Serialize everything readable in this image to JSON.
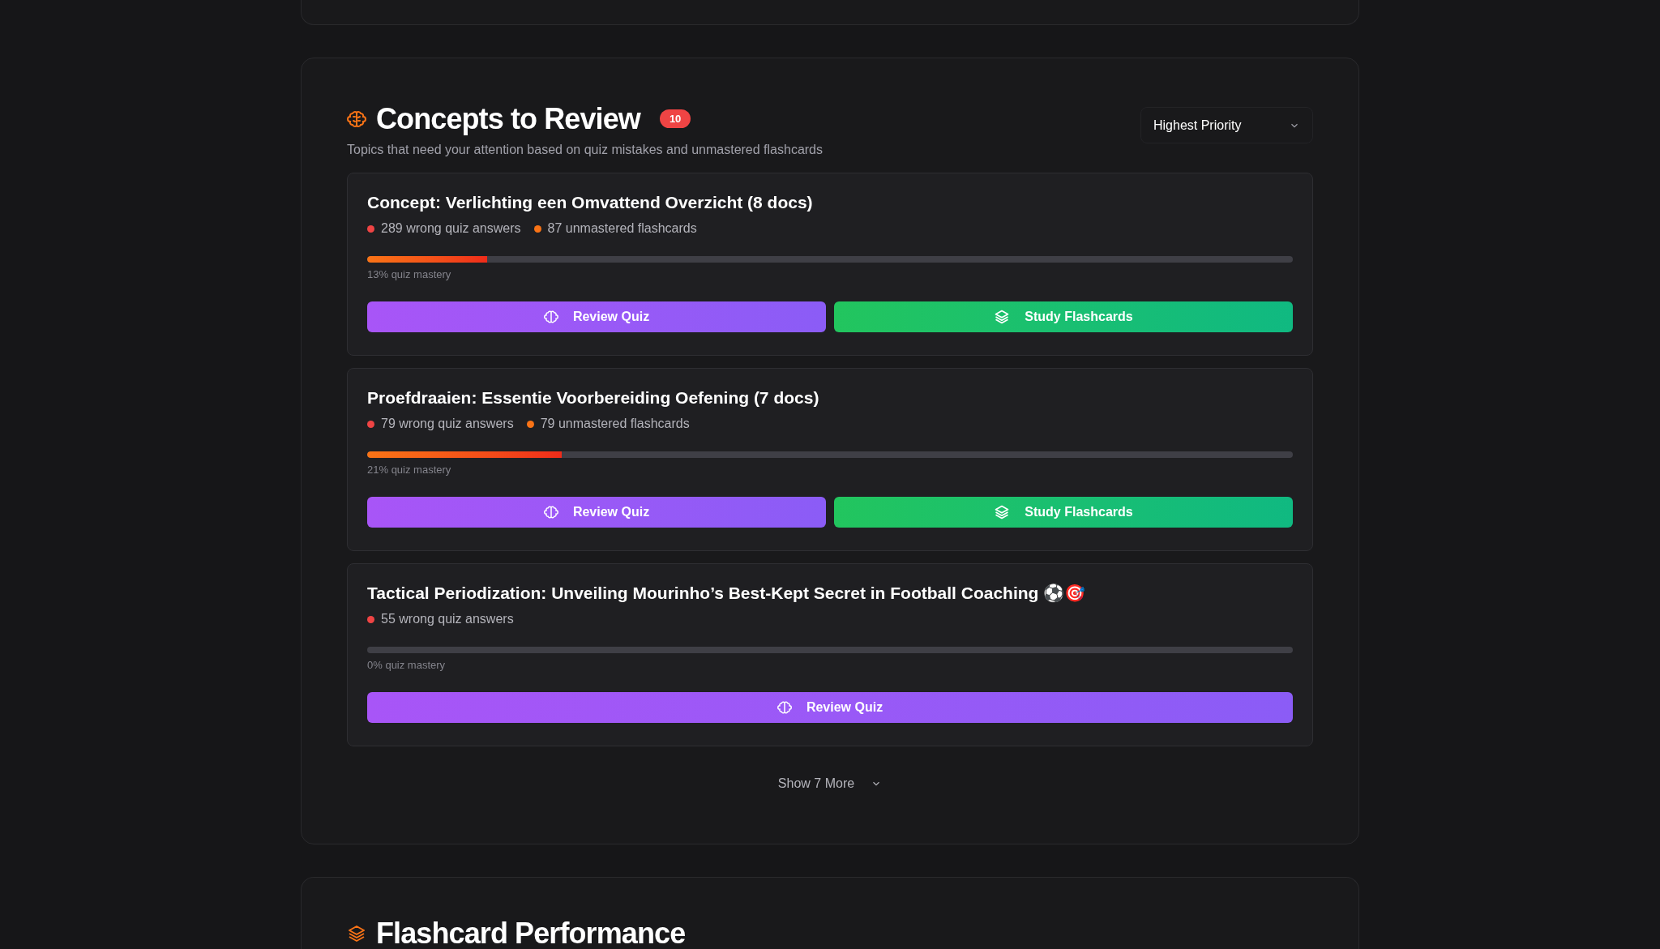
{
  "section": {
    "title": "Concepts to Review",
    "count": "10",
    "subtitle": "Topics that need your attention based on quiz mistakes and unmastered flashcards",
    "sort": {
      "value": "Highest Priority"
    }
  },
  "concepts": [
    {
      "title": "Concept: Verlichting een Omvattend Overzicht (8 docs)",
      "stats": [
        {
          "text": "289 wrong quiz answers",
          "color": "#ef4444"
        },
        {
          "text": "87 unmastered flashcards",
          "color": "#f97316"
        }
      ],
      "level": 0.13,
      "mastery": "13% quiz mastery",
      "buttons": [
        {
          "kind": "quiz",
          "label": "Review Quiz"
        },
        {
          "kind": "flashcards",
          "label": "Study Flashcards"
        }
      ]
    },
    {
      "title": "Proefdraaien: Essentie Voorbereiding Oefening (7 docs)",
      "stats": [
        {
          "text": "79 wrong quiz answers",
          "color": "#ef4444"
        },
        {
          "text": "79 unmastered flashcards",
          "color": "#f97316"
        }
      ],
      "level": 0.21,
      "mastery": "21% quiz mastery",
      "buttons": [
        {
          "kind": "quiz",
          "label": "Review Quiz"
        },
        {
          "kind": "flashcards",
          "label": "Study Flashcards"
        }
      ]
    },
    {
      "title": "Tactical Periodization: Unveiling Mourinho’s Best-Kept Secret in Football Coaching ⚽🎯",
      "stats": [
        {
          "text": "55 wrong quiz answers",
          "color": "#ef4444"
        }
      ],
      "level": 0,
      "mastery": "0% quiz mastery",
      "buttons": [
        {
          "kind": "quiz",
          "label": "Review Quiz"
        }
      ]
    }
  ],
  "show_more": "Show 7 More",
  "next_section": {
    "title": "Flashcard Performance"
  }
}
